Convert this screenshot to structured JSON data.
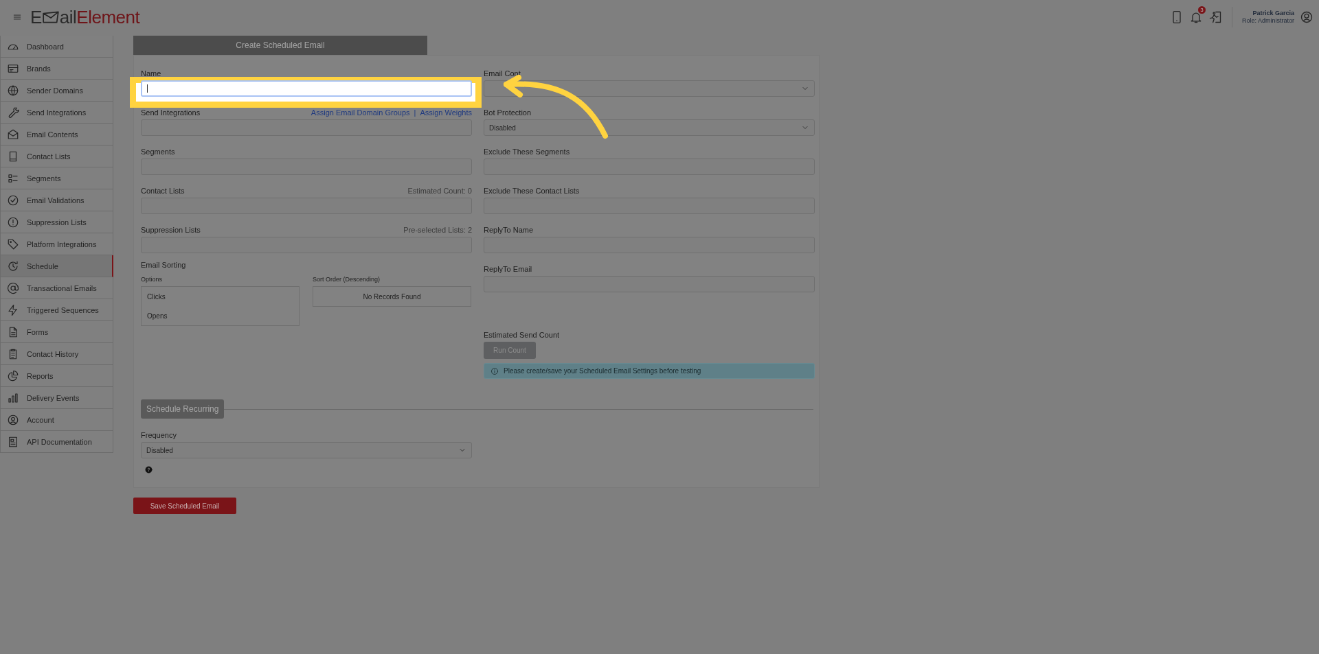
{
  "header": {
    "logo": {
      "lead": "E",
      "rest": "ail",
      "brand": "Element"
    },
    "notification_count": "3",
    "user": {
      "name": "Patrick Garcia",
      "role": "Role: Administrator"
    }
  },
  "sidebar": {
    "items": [
      {
        "label": "Dashboard",
        "selected": false
      },
      {
        "label": "Brands",
        "selected": false
      },
      {
        "label": "Sender Domains",
        "selected": false
      },
      {
        "label": "Send Integrations",
        "selected": false
      },
      {
        "label": "Email Contents",
        "selected": false
      },
      {
        "label": "Contact Lists",
        "selected": false
      },
      {
        "label": "Segments",
        "selected": false
      },
      {
        "label": "Email Validations",
        "selected": false
      },
      {
        "label": "Suppression Lists",
        "selected": false
      },
      {
        "label": "Platform Integrations",
        "selected": false
      },
      {
        "label": "Schedule",
        "selected": true
      },
      {
        "label": "Transactional Emails",
        "selected": false
      },
      {
        "label": "Triggered Sequences",
        "selected": false
      },
      {
        "label": "Forms",
        "selected": false
      },
      {
        "label": "Contact History",
        "selected": false
      },
      {
        "label": "Reports",
        "selected": false
      },
      {
        "label": "Delivery Events",
        "selected": false
      },
      {
        "label": "Account",
        "selected": false
      },
      {
        "label": "API Documentation",
        "selected": false
      }
    ]
  },
  "form": {
    "tab": "Create Scheduled Email",
    "left_fields": [
      {
        "label": "Name",
        "kind": "text",
        "focused": true
      },
      {
        "label": "Send Integrations",
        "kind": "text",
        "focused": false,
        "links": [
          "Assign Email Domain Groups",
          "Assign Weights"
        ],
        "separator": "|"
      },
      {
        "label": "Segments",
        "kind": "text",
        "focused": false
      },
      {
        "label": "Contact Lists",
        "kind": "text",
        "focused": false,
        "note": "Estimated Count: 0"
      },
      {
        "label": "Suppression Lists",
        "kind": "text",
        "focused": false,
        "note": "Pre-selected Lists: 2"
      }
    ],
    "sorting": {
      "title": "Email Sorting",
      "options_label": "Options",
      "options": [
        "Clicks",
        "Opens"
      ],
      "order_label": "Sort Order (Descending)",
      "order_empty": "No Records Found"
    },
    "right_fields": [
      {
        "label": "Email Cont",
        "kind": "select"
      },
      {
        "label": "Bot Protection",
        "kind": "select",
        "value": "Disabled"
      },
      {
        "label": "Exclude These Segments",
        "kind": "text",
        "focused": false
      },
      {
        "label": "Exclude These Contact Lists",
        "kind": "text",
        "focused": false
      },
      {
        "label": "ReplyTo Name",
        "kind": "text",
        "focused": false
      },
      {
        "label": "ReplyTo Email",
        "kind": "text",
        "focused": false
      }
    ],
    "send_count": {
      "label": "Estimated Send Count",
      "button": "Run Count",
      "disabled": true,
      "info": "Please create/save your Scheduled Email Settings before testing"
    },
    "recurring": {
      "button": "Schedule Recurring",
      "frequency_label": "Frequency",
      "frequency_value": "Disabled"
    },
    "save_button": "Save Scheduled Email"
  }
}
